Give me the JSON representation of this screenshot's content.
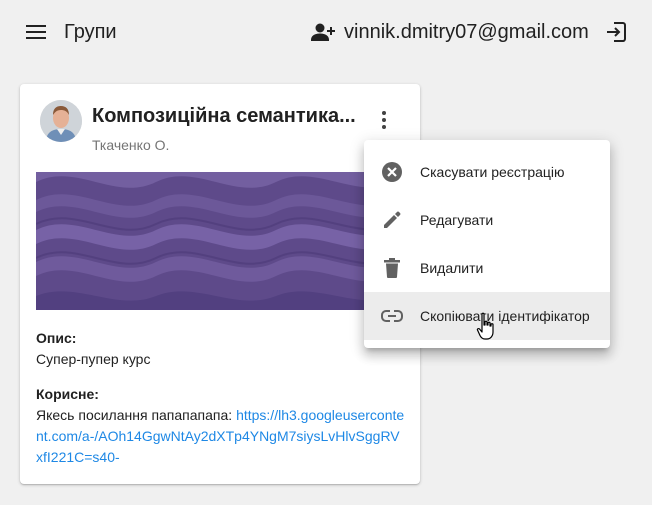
{
  "header": {
    "title": "Групи",
    "user_email": "vinnik.dmitry07@gmail.com"
  },
  "card": {
    "title": "Композиційна семантика...",
    "subtitle": "Ткаченко О.",
    "description_label": "Опис:",
    "description_text": "Супер-пупер курс",
    "useful_label": "Корисне:",
    "useful_text_prefix": "Якесь посилання папапапапа: ",
    "useful_link": "https://lh3.googleusercontent.com/a-/AOh14GgwNtAy2dXTp4YNgM7siysLvHlvSggRVxfI221C=s40-"
  },
  "context_menu": {
    "items": [
      {
        "label": "Скасувати реєстрацію",
        "icon": "cancel-circle-icon"
      },
      {
        "label": "Редагувати",
        "icon": "pencil-icon"
      },
      {
        "label": "Видалити",
        "icon": "trash-icon"
      },
      {
        "label": "Скопіювати ідентифікатор",
        "icon": "link-icon"
      }
    ],
    "hovered_index": 3
  },
  "colors": {
    "background": "#f0f0f0",
    "link": "#1e88e5",
    "banner": "#5e4a8a",
    "icon": "#616161"
  }
}
